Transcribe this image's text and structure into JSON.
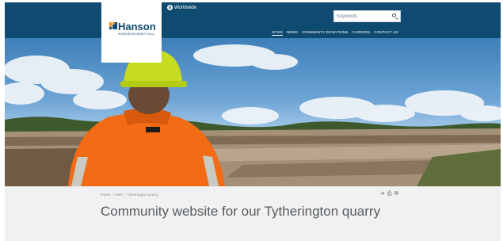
{
  "header": {
    "worldwide_label": "Worldwide",
    "search_placeholder": "Keywords",
    "nav": [
      {
        "label": "SITES",
        "active": true
      },
      {
        "label": "NEWS"
      },
      {
        "label": "COMMUNITY DONATIONS"
      },
      {
        "label": "CAREERS"
      },
      {
        "label": "CONTACT US"
      }
    ]
  },
  "logo": {
    "name": "Hanson",
    "sub": "HEIDELBERGCEMENT Group",
    "grid_colors": [
      "#f28a1c",
      "#f28a1c",
      "#0f4a70",
      "#f28a1c",
      "#0f4a70",
      "#0f4a70",
      "#0f4a70",
      "#0f4a70",
      "#0f4a70"
    ]
  },
  "hero": {
    "image_description": "Worker in orange hi-vis jacket and yellow hard hat overlooking a quarry under a blue sky with clouds",
    "helmet_color": "#c5dc1f",
    "jacket_color": "#f36b14"
  },
  "breadcrumb": [
    "Home",
    "Sites",
    "Tytherington quarry"
  ],
  "share_icons": [
    "share-icon",
    "print-icon",
    "email-icon"
  ],
  "page": {
    "title": "Community website for our Tytherington quarry"
  },
  "colors": {
    "brand_blue": "#0f4a70",
    "background": "#f1f1f1",
    "title_text": "#555b60"
  }
}
